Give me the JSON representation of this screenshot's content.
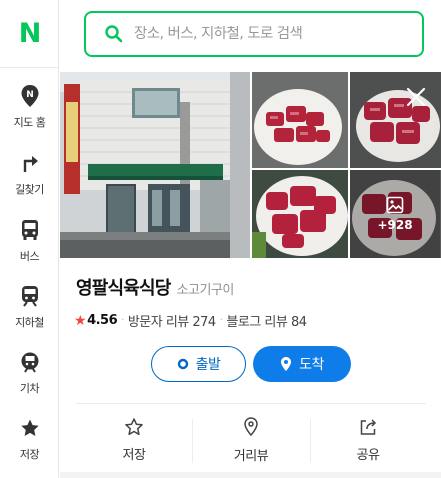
{
  "brand": {
    "logo_text": "N",
    "color": "#03c75a"
  },
  "search": {
    "placeholder": "장소, 버스, 지하철, 도로 검색",
    "value": ""
  },
  "sidebar": {
    "items": [
      {
        "label": "지도 홈",
        "icon": "map-pin-icon"
      },
      {
        "label": "길찾기",
        "icon": "turn-arrow-icon"
      },
      {
        "label": "버스",
        "icon": "bus-icon"
      },
      {
        "label": "지하철",
        "icon": "subway-icon"
      },
      {
        "label": "기차",
        "icon": "train-icon"
      },
      {
        "label": "저장",
        "icon": "star-icon"
      }
    ]
  },
  "place": {
    "name": "영팔식육식당",
    "category": "소고기구이",
    "rating_star": "★",
    "rating": "4.56",
    "visitor_reviews": "방문자 리뷰 274",
    "blog_reviews": "블로그 리뷰 84",
    "photo_more": "+928"
  },
  "route_buttons": {
    "start": "출발",
    "arrive": "도착"
  },
  "actions": [
    {
      "label": "저장",
      "icon": "star-outline-icon"
    },
    {
      "label": "거리뷰",
      "icon": "street-view-icon"
    },
    {
      "label": "공유",
      "icon": "share-icon"
    }
  ],
  "colors": {
    "accent_blue": "#0e7de9",
    "start_blue": "#0068c3",
    "rating_red": "#f5443b"
  }
}
